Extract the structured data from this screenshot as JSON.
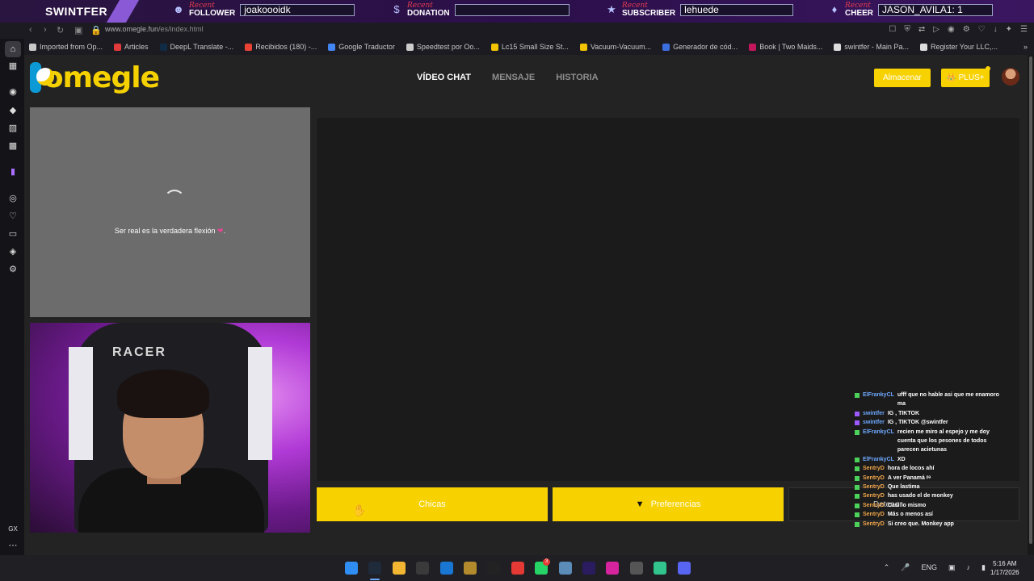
{
  "overlay": {
    "brand": "SWINTFER",
    "follower": {
      "recent": "Recent",
      "type": "FOLLOWER",
      "value": "joakooo​idk"
    },
    "donation": {
      "recent": "Recent",
      "type": "DONATION",
      "value": ""
    },
    "subscriber": {
      "recent": "Recent",
      "type": "SUBSCRIBER",
      "value": "lehuede"
    },
    "cheer": {
      "recent": "Recent",
      "type": "CHEER",
      "value": "JASON_AVILA1: 1"
    }
  },
  "browser": {
    "url_host": "www.omegle.fun",
    "url_path": "/es/index.html",
    "bookmarks": [
      {
        "label": "Imported from Op...",
        "color": "#c8c8c8"
      },
      {
        "label": "Articles",
        "color": "#e03a3a"
      },
      {
        "label": "DeepL Translate -...",
        "color": "#0f2b46"
      },
      {
        "label": "Recibidos (180) -...",
        "color": "#ea4335"
      },
      {
        "label": "Google Traductor",
        "color": "#4285f4"
      },
      {
        "label": "Speedtest por Oo...",
        "color": "#cccccc"
      },
      {
        "label": "Lc15 Small Size St...",
        "color": "#f3c300"
      },
      {
        "label": "Vacuum-Vacuum...",
        "color": "#f3c300"
      },
      {
        "label": "Generador de cód...",
        "color": "#3b6fe0"
      },
      {
        "label": "Book | Two Maids...",
        "color": "#c2185b"
      },
      {
        "label": "swintfer - Main Pa...",
        "color": "#dddddd"
      },
      {
        "label": "Register Your LLC,...",
        "color": "#dddddd"
      }
    ]
  },
  "site": {
    "logo_text": "omegle",
    "nav": {
      "video_chat": "VÍDEO CHAT",
      "messages": "MENSAJE",
      "history": "HISTORIA"
    },
    "store_button": "Almacenar",
    "plus_button": "👑 PLUS+",
    "loading_text": "Ser real es la verdadera flexión",
    "chair_brand": "RACER",
    "buttons": {
      "girls": "Chicas",
      "preferences": "Preferencias",
      "stop": "Detener"
    }
  },
  "chat": [
    {
      "user": "ElFrankyCL",
      "color": "#6ea8ff",
      "badge": "#4cd25a",
      "msg": "ufff que no hable asi que me enamoro ma"
    },
    {
      "user": "swintfer",
      "color": "#6ea8ff",
      "badge": "#9b59ff",
      "msg": "IG , TIKTOK"
    },
    {
      "user": "swintfer",
      "color": "#6ea8ff",
      "badge": "#9b59ff",
      "msg": "IG , TIKTOK @swintfer"
    },
    {
      "user": "ElFrankyCL",
      "color": "#6ea8ff",
      "badge": "#4cd25a",
      "msg": "recien me miro al espejo y me doy cuenta que los pesones de todos parecen acietunas"
    },
    {
      "user": "ElFrankyCL",
      "color": "#6ea8ff",
      "badge": "#4cd25a",
      "msg": "XD"
    },
    {
      "user": "SentryD",
      "color": "#f0a64a",
      "badge": "#4cd25a",
      "msg": "hora de locos ahí"
    },
    {
      "user": "SentryD",
      "color": "#f0a64a",
      "badge": "#4cd25a",
      "msg": "A ver Panamá ᵖᵃ"
    },
    {
      "user": "SentryD",
      "color": "#f0a64a",
      "badge": "#4cd25a",
      "msg": "Que lastima"
    },
    {
      "user": "SentryD",
      "color": "#f0a64a",
      "badge": "#4cd25a",
      "msg": "has usado el de monkey"
    },
    {
      "user": "SentryD",
      "color": "#f0a64a",
      "badge": "#4cd25a",
      "msg": "Casi lo mismo"
    },
    {
      "user": "SentryD",
      "color": "#f0a64a",
      "badge": "#4cd25a",
      "msg": "Más o menos así"
    },
    {
      "user": "SentryD",
      "color": "#f0a64a",
      "badge": "#4cd25a",
      "msg": "Si creo que. Monkey app"
    }
  ],
  "taskbar": {
    "lang": "ENG",
    "time": "5:16 AM",
    "date": "1/17/2026",
    "whatsapp_badge": "3",
    "apps": [
      {
        "icon": "windows-icon",
        "color": "#2f8ef4"
      },
      {
        "icon": "opera-gx-icon",
        "color": "#1f2a3a"
      },
      {
        "icon": "file-explorer-icon",
        "color": "#f2b632"
      },
      {
        "icon": "store-icon",
        "color": "#3a3a3a"
      },
      {
        "icon": "outlook-icon",
        "color": "#1976d2"
      },
      {
        "icon": "league-icon",
        "color": "#b38b2d"
      },
      {
        "icon": "g-hub-icon",
        "color": "#222"
      },
      {
        "icon": "bolt-app-icon",
        "color": "#e53935"
      },
      {
        "icon": "whatsapp-icon",
        "color": "#25d366"
      },
      {
        "icon": "steam-icon",
        "color": "#5b8bb7"
      },
      {
        "icon": "premiere-icon",
        "color": "#2b1b5f"
      },
      {
        "icon": "instagram-icon",
        "color": "#d6249f"
      },
      {
        "icon": "streamlabs-icon",
        "color": "#555"
      },
      {
        "icon": "discord-alt-icon",
        "color": "#31c48d"
      },
      {
        "icon": "discord-icon",
        "color": "#5865f2"
      }
    ]
  }
}
